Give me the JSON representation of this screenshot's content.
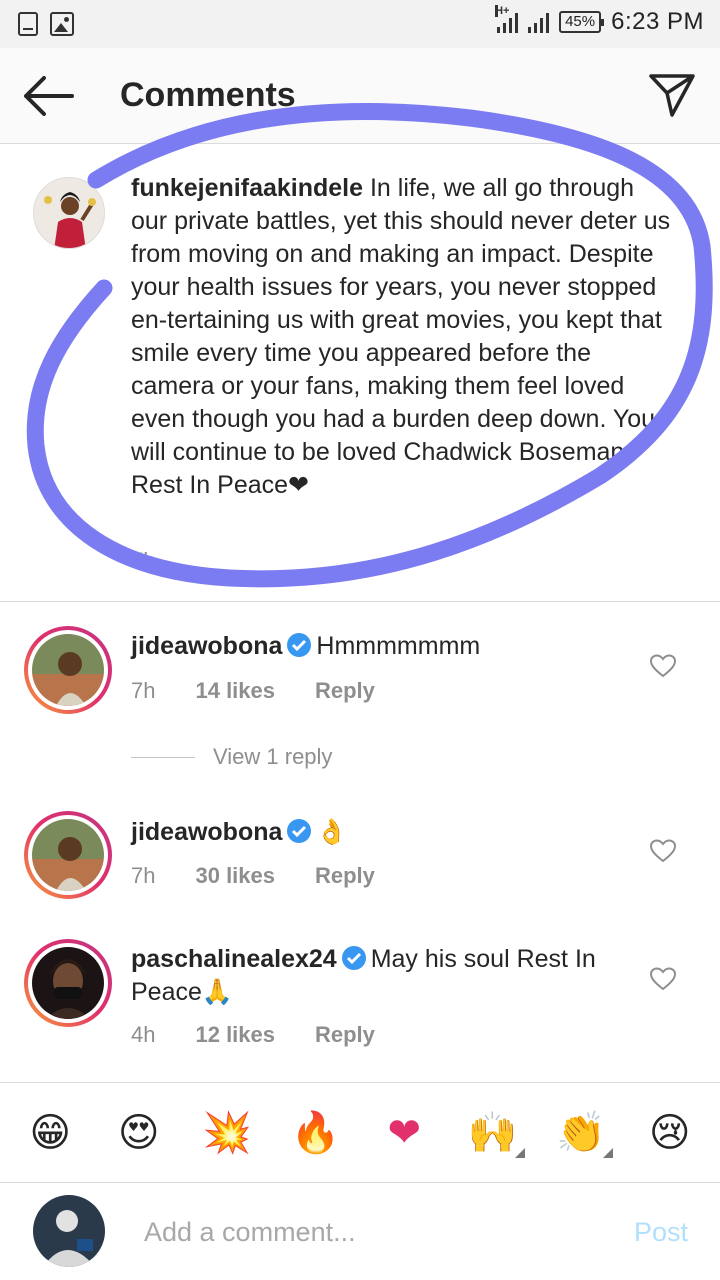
{
  "status_bar": {
    "network": "H+",
    "battery": "45%",
    "time": "6:23 PM"
  },
  "header": {
    "title": "Comments"
  },
  "caption": {
    "username": "funkejenifaakindele",
    "text": " In life, we all go through our private battles, yet this should never deter us from moving on and making an impact. Despite your health issues for  years, you never stopped en-tertaining us with great movies, you kept that smile every time you appeared before the camera or your fans, making them feel loved even though you had a burden deep down. You will continue to be loved Chadwick Boseman. Rest In Peace❤",
    "time": "7h"
  },
  "comments": [
    {
      "username": "jideawobona",
      "verified": true,
      "text": "Hmmmmmmm",
      "time": "7h",
      "likes": "14 likes",
      "reply": "Reply"
    },
    {
      "username": "jideawobona",
      "verified": true,
      "text": "👌",
      "time": "7h",
      "likes": "30 likes",
      "reply": "Reply"
    },
    {
      "username": "paschalinealex24",
      "verified": true,
      "text": "May his soul Rest In Peace🙏",
      "time": "4h",
      "likes": "12 likes",
      "reply": "Reply"
    }
  ],
  "view_reply": "View 1 reply",
  "emoji_bar": [
    "😁",
    "😍",
    "💥",
    "🔥",
    "❤",
    "🙌",
    "👏",
    "😢"
  ],
  "composer": {
    "placeholder": "Add a comment...",
    "post_label": "Post"
  },
  "colors": {
    "accent_blue": "#3897f0",
    "post_disabled": "#b2dffc",
    "scribble": "#7b7bf2"
  }
}
